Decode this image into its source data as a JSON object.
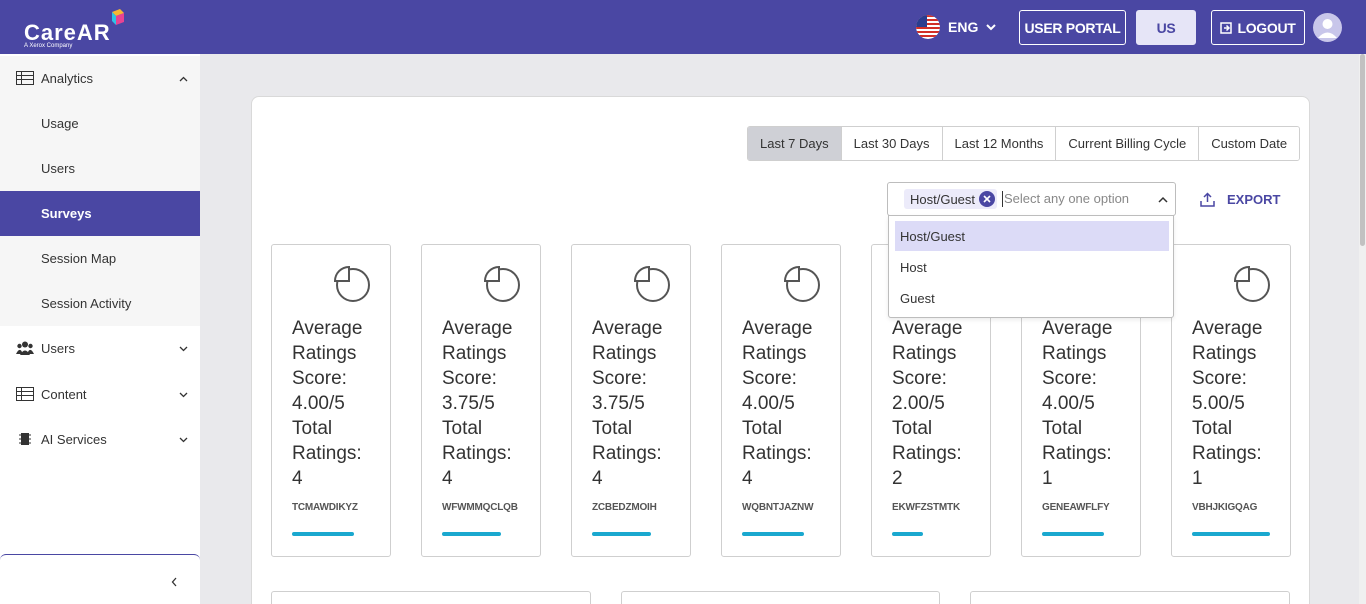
{
  "header": {
    "brand": "CareAR",
    "brand_tagline": "A Xerox Company",
    "language": "ENG",
    "user_portal_label": "USER PORTAL",
    "region_label": "US",
    "logout_label": "LOGOUT"
  },
  "sidebar": {
    "items": [
      {
        "label": "Analytics",
        "icon": "table-icon",
        "expanded": true
      },
      {
        "label": "Usage"
      },
      {
        "label": "Users"
      },
      {
        "label": "Surveys",
        "active": true
      },
      {
        "label": "Session Map"
      },
      {
        "label": "Session Activity"
      },
      {
        "label": "Users",
        "icon": "users-icon"
      },
      {
        "label": "Content",
        "icon": "table-icon"
      },
      {
        "label": "AI Services",
        "icon": "chip-icon"
      }
    ]
  },
  "date_range": {
    "options": [
      "Last 7 Days",
      "Last 30 Days",
      "Last 12 Months",
      "Current Billing Cycle",
      "Custom Date"
    ],
    "selected": "Last 7 Days"
  },
  "role_select": {
    "selected_chip": "Host/Guest",
    "placeholder": "Select any one option",
    "options": [
      "Host/Guest",
      "Host",
      "Guest"
    ],
    "highlighted": "Host/Guest"
  },
  "export_label": "EXPORT",
  "cards": [
    {
      "avg_label": "Average Ratings Score:",
      "score": "4.00/5",
      "total_label": "Total Ratings:",
      "total": "4",
      "code": "TCMAWDIKYZ",
      "bar": 0.8
    },
    {
      "avg_label": "Average Ratings Score:",
      "score": "3.75/5",
      "total_label": "Total Ratings:",
      "total": "4",
      "code": "WFWMMQCLQB",
      "bar": 0.75
    },
    {
      "avg_label": "Average Ratings Score:",
      "score": "3.75/5",
      "total_label": "Total Ratings:",
      "total": "4",
      "code": "ZCBEDZMOIH",
      "bar": 0.75
    },
    {
      "avg_label": "Average Ratings Score:",
      "score": "4.00/5",
      "total_label": "Total Ratings:",
      "total": "4",
      "code": "WQBNTJAZNW",
      "bar": 0.8
    },
    {
      "avg_label": "Average Ratings Score:",
      "score": "2.00/5",
      "total_label": "Total Ratings:",
      "total": "2",
      "code": "EKWFZSTMTK",
      "bar": 0.4
    },
    {
      "avg_label": "Average Ratings Score:",
      "score": "4.00/5",
      "total_label": "Total Ratings:",
      "total": "1",
      "code": "GENEAWFLFY",
      "bar": 0.8
    },
    {
      "avg_label": "Average Ratings Score:",
      "score": "5.00/5",
      "total_label": "Total Ratings:",
      "total": "1",
      "code": "VBHJKIGQAG",
      "bar": 1.0
    }
  ],
  "colors": {
    "brand": "#4a47a3",
    "accent_bar": "#1aa8cf",
    "chip_bg": "#ecebfa",
    "highlight": "#dcdbf7"
  }
}
